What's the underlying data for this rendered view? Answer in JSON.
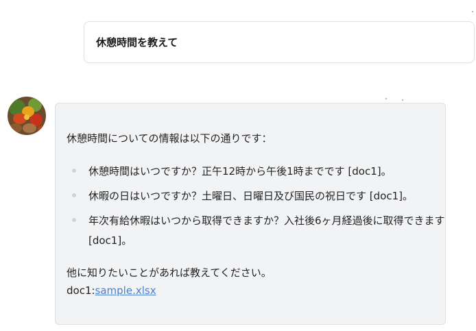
{
  "user_message": {
    "text": "休憩時間を教えて"
  },
  "assistant": {
    "avatar_icon": "vegetables-avatar-icon",
    "intro": "休憩時間についての情報は以下の通りです：",
    "items": [
      {
        "text": "休憩時間はいつですか？正午12時から午後1時までです [doc1]。"
      },
      {
        "text": "休暇の日はいつですか？土曜日、日曜日及び国民の祝日です [doc1]。"
      },
      {
        "text_line1": "年次有給休暇はいつから取得できますか？入社後6ヶ月経過後に取得できます",
        "text_line2": "[doc1]。"
      }
    ],
    "outro": "他に知りたいことがあれば教えてください。",
    "citation_prefix": "doc1:",
    "citation_link": "sample.xlsx"
  },
  "colors": {
    "bubble_bg": "#f2f3f5",
    "link": "#4a7fd0"
  }
}
